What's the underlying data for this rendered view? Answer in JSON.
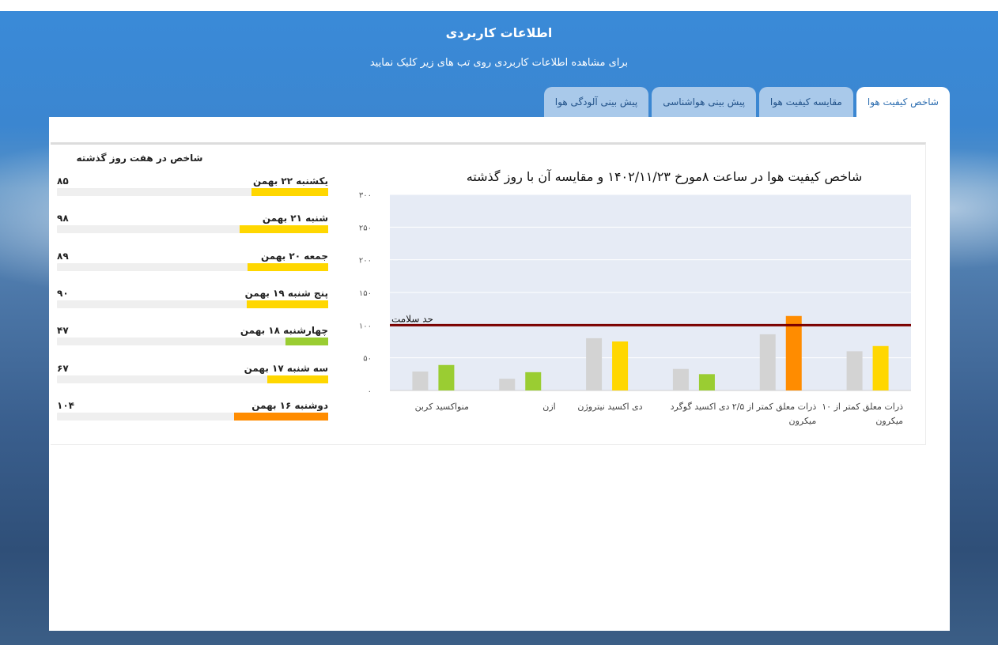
{
  "header": {
    "title": "اطلاعات کاربردی",
    "subtitle": "برای مشاهده اطلاعات کاربردی روی تب های زیر کلیک نمایید"
  },
  "tabs": [
    {
      "label": "شاخص کیفیت هوا",
      "active": true
    },
    {
      "label": "مقایسه کیفیت هوا",
      "active": false
    },
    {
      "label": "پیش بینی هواشناسی",
      "active": false
    },
    {
      "label": "پیش بینی آلودگی هوا",
      "active": false
    }
  ],
  "seven_days": {
    "title": "شاخص در هفت روز گذشته",
    "max": 300,
    "days": [
      {
        "name": "یکشنبه ۲۲ بهمن",
        "value": 85,
        "display": "۸۵",
        "color": "#ffd700"
      },
      {
        "name": "شنبه ۲۱ بهمن",
        "value": 98,
        "display": "۹۸",
        "color": "#ffd700"
      },
      {
        "name": "جمعه ۲۰ بهمن",
        "value": 89,
        "display": "۸۹",
        "color": "#ffd700"
      },
      {
        "name": "پنج شنبه ۱۹ بهمن",
        "value": 90,
        "display": "۹۰",
        "color": "#ffd700"
      },
      {
        "name": "چهارشنبه ۱۸ بهمن",
        "value": 47,
        "display": "۴۷",
        "color": "#9acd32"
      },
      {
        "name": "سه شنبه ۱۷ بهمن",
        "value": 67,
        "display": "۶۷",
        "color": "#ffd700"
      },
      {
        "name": "دوشنبه ۱۶ بهمن",
        "value": 104,
        "display": "۱۰۴",
        "color": "#ff8c00"
      }
    ]
  },
  "chart_data": {
    "type": "bar",
    "title": "شاخص کیفیت هوا در ساعت ۸مورخ ۱۴۰۲/۱۱/۲۳ و مقایسه آن با روز گذشته",
    "ylim": [
      0,
      300
    ],
    "yticks": [
      0,
      50,
      100,
      150,
      200,
      250,
      300
    ],
    "ytick_labels": [
      "۰",
      "۵۰",
      "۱۰۰",
      "۱۵۰",
      "۲۰۰",
      "۲۵۰",
      "۳۰۰"
    ],
    "grid": true,
    "threshold": {
      "label": "حد سلامت",
      "value": 100,
      "color": "#7b0000"
    },
    "categories": [
      [
        "ذرات معلق کمتر از ۱۰",
        "میکرون"
      ],
      [
        "ذرات معلق کمتر از ۲/۵",
        "میکرون"
      ],
      [
        "دی اکسید گوگرد"
      ],
      [
        "دی اکسید نیتروژن"
      ],
      [
        "ازن"
      ],
      [
        "منواکسید کربن"
      ]
    ],
    "series": [
      {
        "values": [
          60,
          86,
          33,
          80,
          18,
          29
        ],
        "colors": [
          "#d3d3d3",
          "#d3d3d3",
          "#d3d3d3",
          "#d3d3d3",
          "#d3d3d3",
          "#d3d3d3"
        ]
      },
      {
        "values": [
          68,
          114,
          25,
          75,
          28,
          39
        ],
        "colors": [
          "#ffd700",
          "#ff8c00",
          "#9acd32",
          "#ffd700",
          "#9acd32",
          "#9acd32"
        ]
      }
    ]
  }
}
